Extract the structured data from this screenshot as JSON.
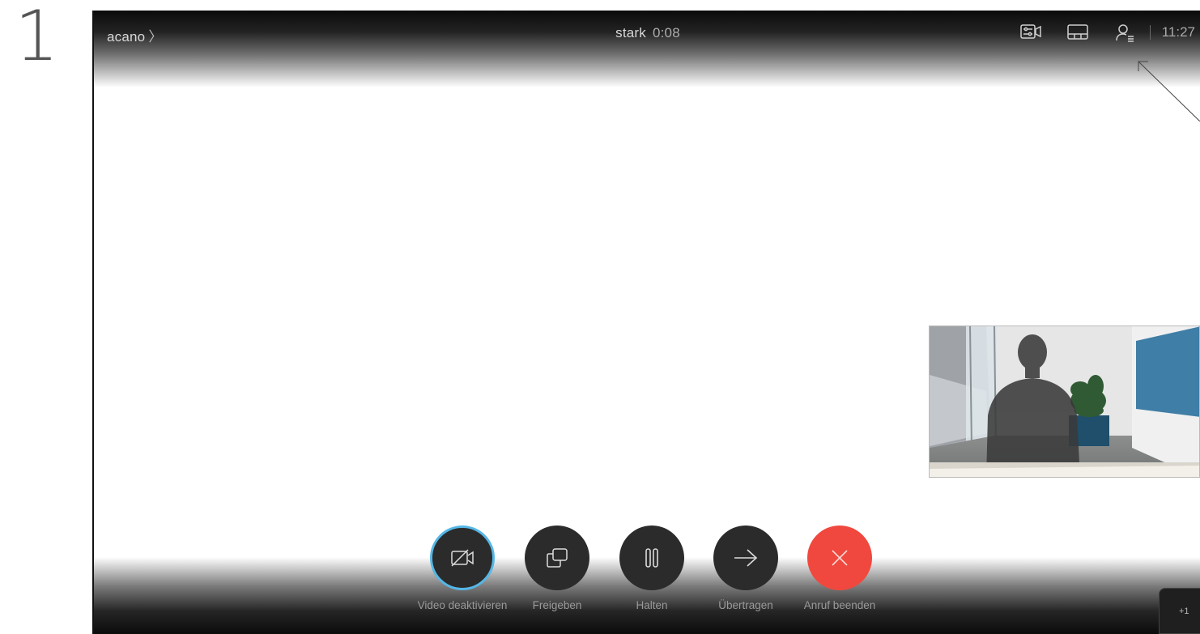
{
  "step": {
    "number": "1"
  },
  "header": {
    "breadcrumb": "acano",
    "chevron": "〉",
    "call_name": "stark",
    "call_duration": "0:08",
    "clock": "11:27",
    "icons": [
      "camera-settings-icon",
      "layout-icon",
      "participants-icon"
    ]
  },
  "controls": {
    "video": "Video deaktivieren",
    "share": "Freigeben",
    "hold": "Halten",
    "transfer": "Übertragen",
    "end": "Anruf beenden"
  },
  "more": {
    "label": "+1"
  },
  "colors": {
    "accent_ring": "#55b7e6",
    "end_call": "#f0483e",
    "button_bg": "#2b2b2b",
    "label": "#9a9a9a"
  }
}
